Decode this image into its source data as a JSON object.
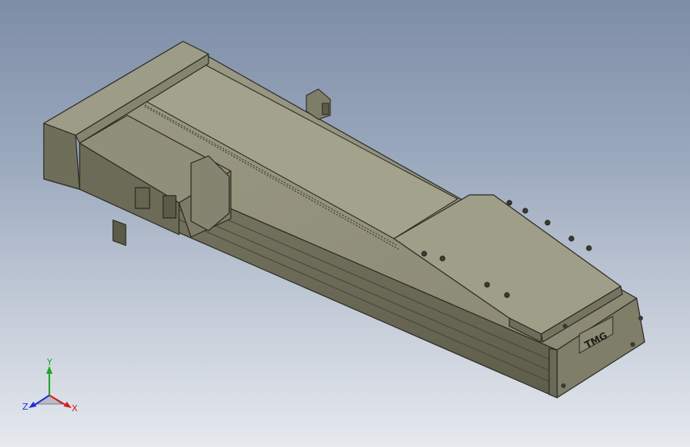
{
  "viewport": {
    "background_top": "#7d8da6",
    "background_bottom": "#e6e9ee"
  },
  "model": {
    "brand_plate_text": "TMG",
    "body_color": "#8e8d78",
    "edge_color": "#2b2b24"
  },
  "triad": {
    "x_label": "X",
    "y_label": "Y",
    "z_label": "Z",
    "x_color": "#d42020",
    "y_color": "#1fa52a",
    "z_color": "#2030d0"
  }
}
